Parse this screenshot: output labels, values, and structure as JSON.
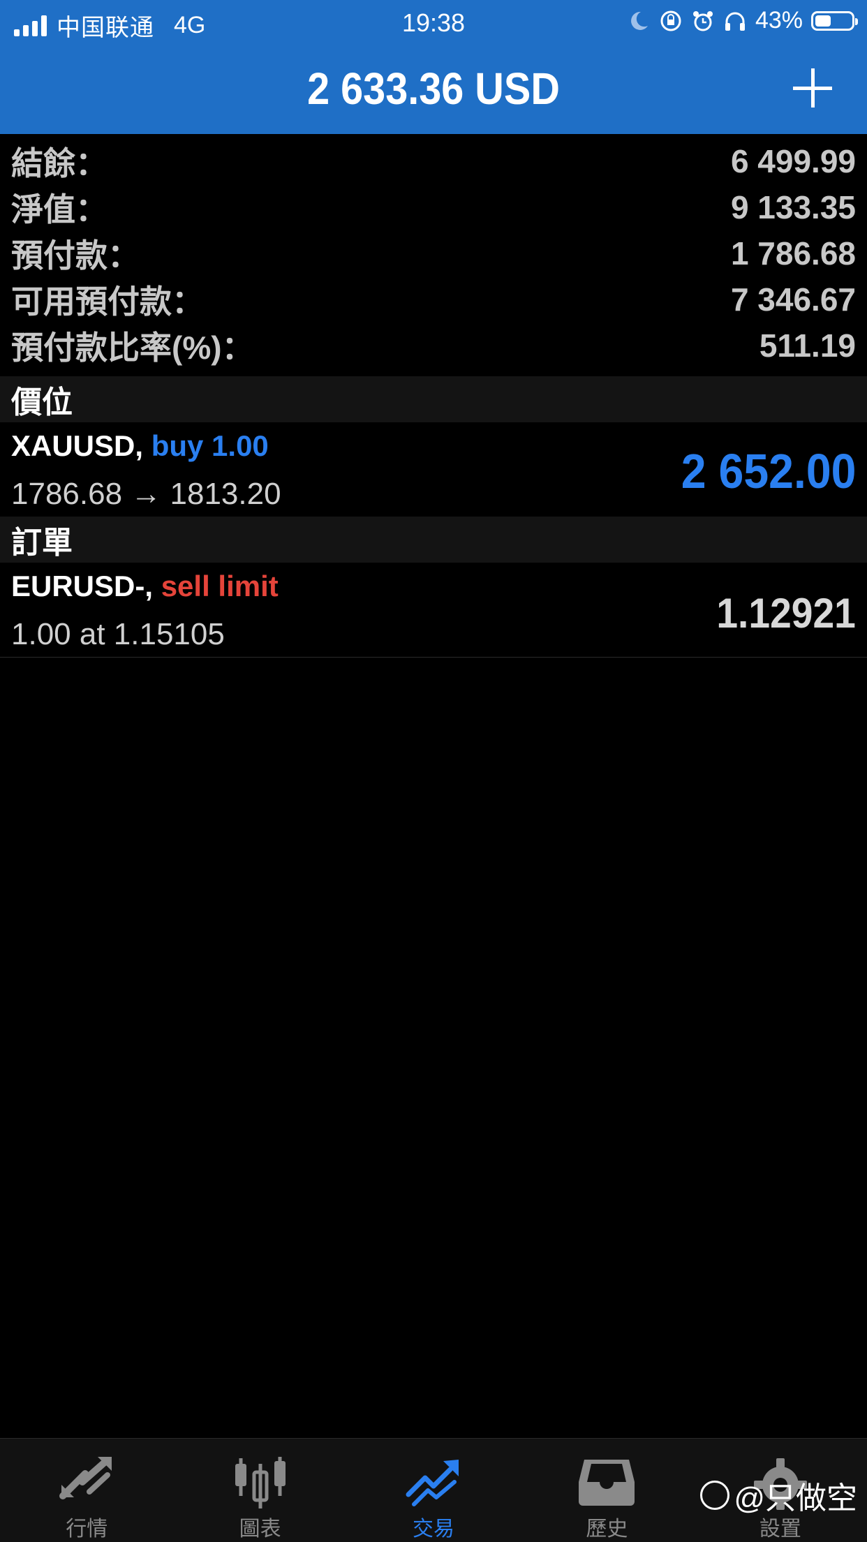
{
  "status_bar": {
    "carrier": "中国联通",
    "network": "4G",
    "time": "19:38",
    "battery": "43%",
    "battery_level": 0.43
  },
  "nav": {
    "title": "2 633.36 USD"
  },
  "summary": [
    {
      "label": "結餘：",
      "value": "6 499.99"
    },
    {
      "label": "淨值：",
      "value": "9 133.35"
    },
    {
      "label": "預付款：",
      "value": "1 786.68"
    },
    {
      "label": "可用預付款：",
      "value": "7 346.67"
    },
    {
      "label": "預付款比率(%)：",
      "value": "511.19"
    }
  ],
  "positions": {
    "header": "價位",
    "items": [
      {
        "symbol": "XAUUSD,",
        "action": "buy 1.00",
        "prices": "1786.68 → 1813.20",
        "profit": "2 652.00"
      }
    ]
  },
  "orders": {
    "header": "訂單",
    "items": [
      {
        "symbol": "EURUSD-,",
        "action": "sell limit",
        "detail": "1.00 at 1.15105",
        "price": "1.12921"
      }
    ]
  },
  "tabs": [
    {
      "label": "行情",
      "icon": "quotes-arrows-icon",
      "active": false
    },
    {
      "label": "圖表",
      "icon": "candlestick-chart-icon",
      "active": false
    },
    {
      "label": "交易",
      "icon": "trade-trend-icon",
      "active": true
    },
    {
      "label": "歷史",
      "icon": "history-inbox-icon",
      "active": false
    },
    {
      "label": "設置",
      "icon": "settings-gear-icon",
      "active": false
    }
  ],
  "watermark": "@只做空",
  "colors": {
    "header_blue": "#1f6fc6",
    "buy_blue": "#2a7ff0",
    "sell_red": "#e5443a",
    "background": "#000000"
  }
}
